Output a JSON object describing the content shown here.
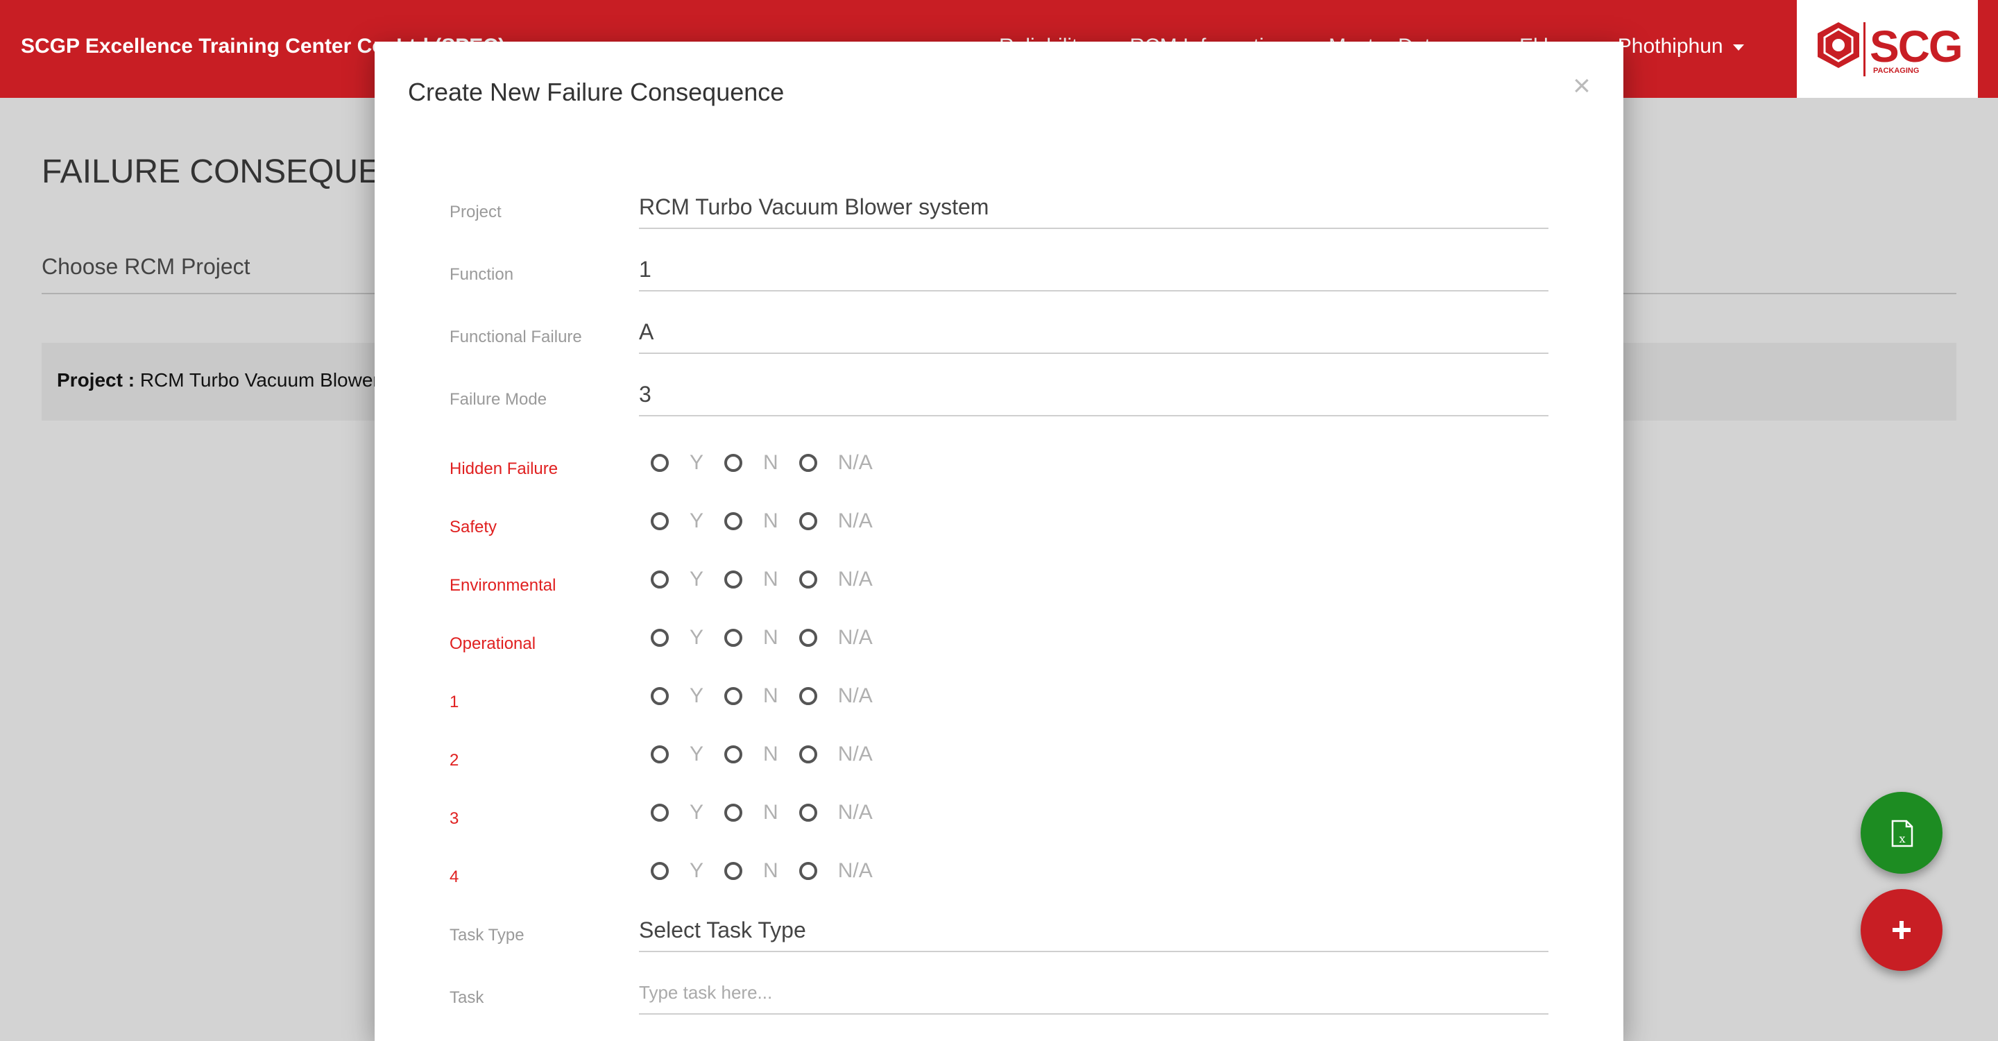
{
  "navbar": {
    "brand": "SCGP Excellence Training Center Co.,Ltd (SPEC)",
    "links": [
      "Reliability",
      "RCM Information",
      "Master Data"
    ],
    "user_name": "Ekkapong Phothiphun",
    "logo_text": "SCG",
    "logo_sub": "PACKAGING",
    "brand_color": "#c81e24"
  },
  "page": {
    "title": "FAILURE CONSEQUENCE",
    "choose_project": "Choose RCM Project",
    "project_label": "Project :",
    "project_value": "RCM Turbo Vacuum Blower system"
  },
  "fabs": {
    "excel_icon": "excel-file-icon",
    "add_icon": "plus-icon"
  },
  "modal": {
    "title": "Create New Failure Consequence",
    "close": "×",
    "fields": [
      {
        "label": "Project",
        "value": "RCM Turbo Vacuum Blower system"
      },
      {
        "label": "Function",
        "value": "1"
      },
      {
        "label": "Functional Failure",
        "value": "A"
      },
      {
        "label": "Failure Mode",
        "value": "3"
      }
    ],
    "radio_options": [
      "Y",
      "N",
      "N/A"
    ],
    "radio_rows": [
      {
        "label": "Hidden Failure"
      },
      {
        "label": "Safety"
      },
      {
        "label": "Environmental"
      },
      {
        "label": "Operational"
      },
      {
        "label": "1"
      },
      {
        "label": "2"
      },
      {
        "label": "3"
      },
      {
        "label": "4"
      }
    ],
    "task_type": {
      "label": "Task Type",
      "value": "Select Task Type"
    },
    "task": {
      "label": "Task",
      "placeholder": "Type task here..."
    }
  }
}
